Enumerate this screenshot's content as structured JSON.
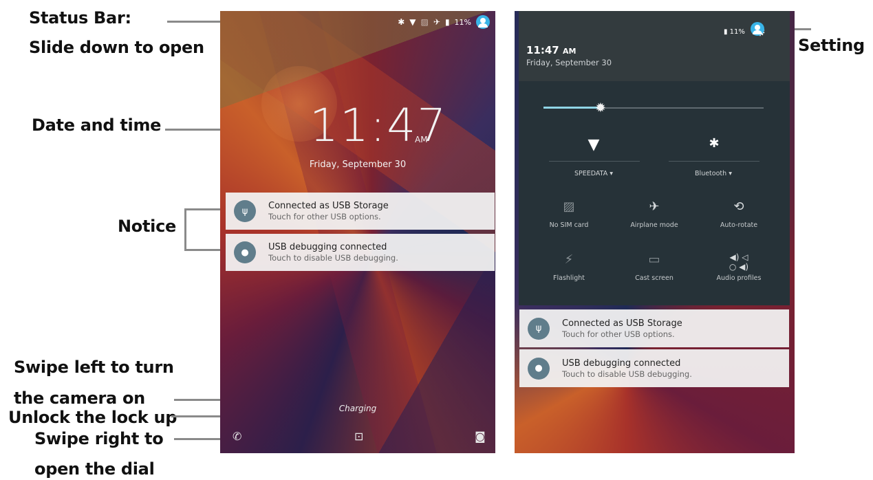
{
  "annotations": {
    "status_bar": "Status Bar:",
    "slide_down": "Slide down to open",
    "date_time": "Date and time",
    "notice": "Notice",
    "swipe_left_1": "Swipe left to turn",
    "swipe_left_2": "the camera on",
    "unlock": "Unlock the lock up",
    "swipe_right_1": "Swipe right to",
    "swipe_right_2": "open the dial",
    "setting": "Setting"
  },
  "lock_screen": {
    "status": {
      "battery": "11%"
    },
    "time": "11:47",
    "ampm": "AM",
    "date": "Friday, September 30",
    "notifications": [
      {
        "title": "Connected as USB Storage",
        "subtitle": "Touch for other USB options."
      },
      {
        "title": "USB debugging connected",
        "subtitle": "Touch to disable USB debugging."
      }
    ],
    "charging": "Charging"
  },
  "quick_settings": {
    "battery": "11%",
    "time": "11:47",
    "ampm": "AM",
    "date": "Friday, September 30",
    "brightness_level": 0.27,
    "wifi_label": "SPEEDATA",
    "bluetooth_label": "Bluetooth",
    "tiles": [
      {
        "label": "No SIM card",
        "icon": "no-sim-icon"
      },
      {
        "label": "Airplane mode",
        "icon": "airplane-icon"
      },
      {
        "label": "Auto-rotate",
        "icon": "auto-rotate-icon"
      },
      {
        "label": "Flashlight",
        "icon": "flashlight-icon"
      },
      {
        "label": "Cast screen",
        "icon": "cast-icon"
      },
      {
        "label": "Audio profiles",
        "icon": "audio-profiles-icon"
      }
    ],
    "notifications": [
      {
        "title": "Connected as USB Storage",
        "subtitle": "Touch for other USB options."
      },
      {
        "title": "USB debugging connected",
        "subtitle": "Touch to disable USB debugging."
      }
    ]
  },
  "colors": {
    "panel_dark": "#263238",
    "panel_header": "#333b3e",
    "accent": "#8fd5e6",
    "avatar": "#39b4e8",
    "notif_icon": "#607d8b"
  }
}
